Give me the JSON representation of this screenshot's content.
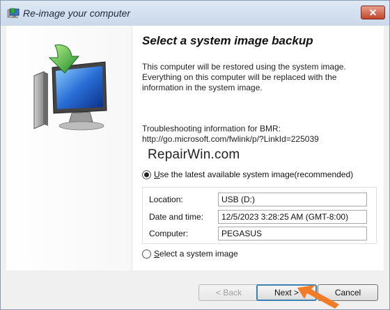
{
  "window": {
    "title": "Re-image your computer"
  },
  "page": {
    "heading": "Select a system image backup",
    "description": "This computer will be restored using the system image. Everything on this computer will be replaced with the information in the system image.",
    "troubleshoot_line1": "Troubleshooting information for BMR:",
    "troubleshoot_line2": "http://go.microsoft.com/fwlink/p/?LinkId=225039",
    "watermark": "RepairWin.com"
  },
  "options": {
    "latest": {
      "label_u": "U",
      "label_rest": "se the latest available system image(recommended)",
      "selected": true
    },
    "select": {
      "label_u": "S",
      "label_rest": "elect a system image",
      "selected": false
    }
  },
  "details": {
    "location_label": "Location:",
    "location_value": "USB (D:)",
    "datetime_label": "Date and time:",
    "datetime_value": "12/5/2023 3:28:25 AM (GMT-8:00)",
    "computer_label": "Computer:",
    "computer_value": "PEGASUS"
  },
  "buttons": {
    "back": "< Back",
    "next": "Next >",
    "cancel": "Cancel"
  },
  "icons": {
    "title": "reimage-computer-icon",
    "close": "close-icon",
    "hero": "restore-computer-icon",
    "pointer": "orange-arrow-icon"
  },
  "colors": {
    "accent": "#3c7fb1",
    "close": "#c0452e",
    "arrow": "#f07c28"
  }
}
